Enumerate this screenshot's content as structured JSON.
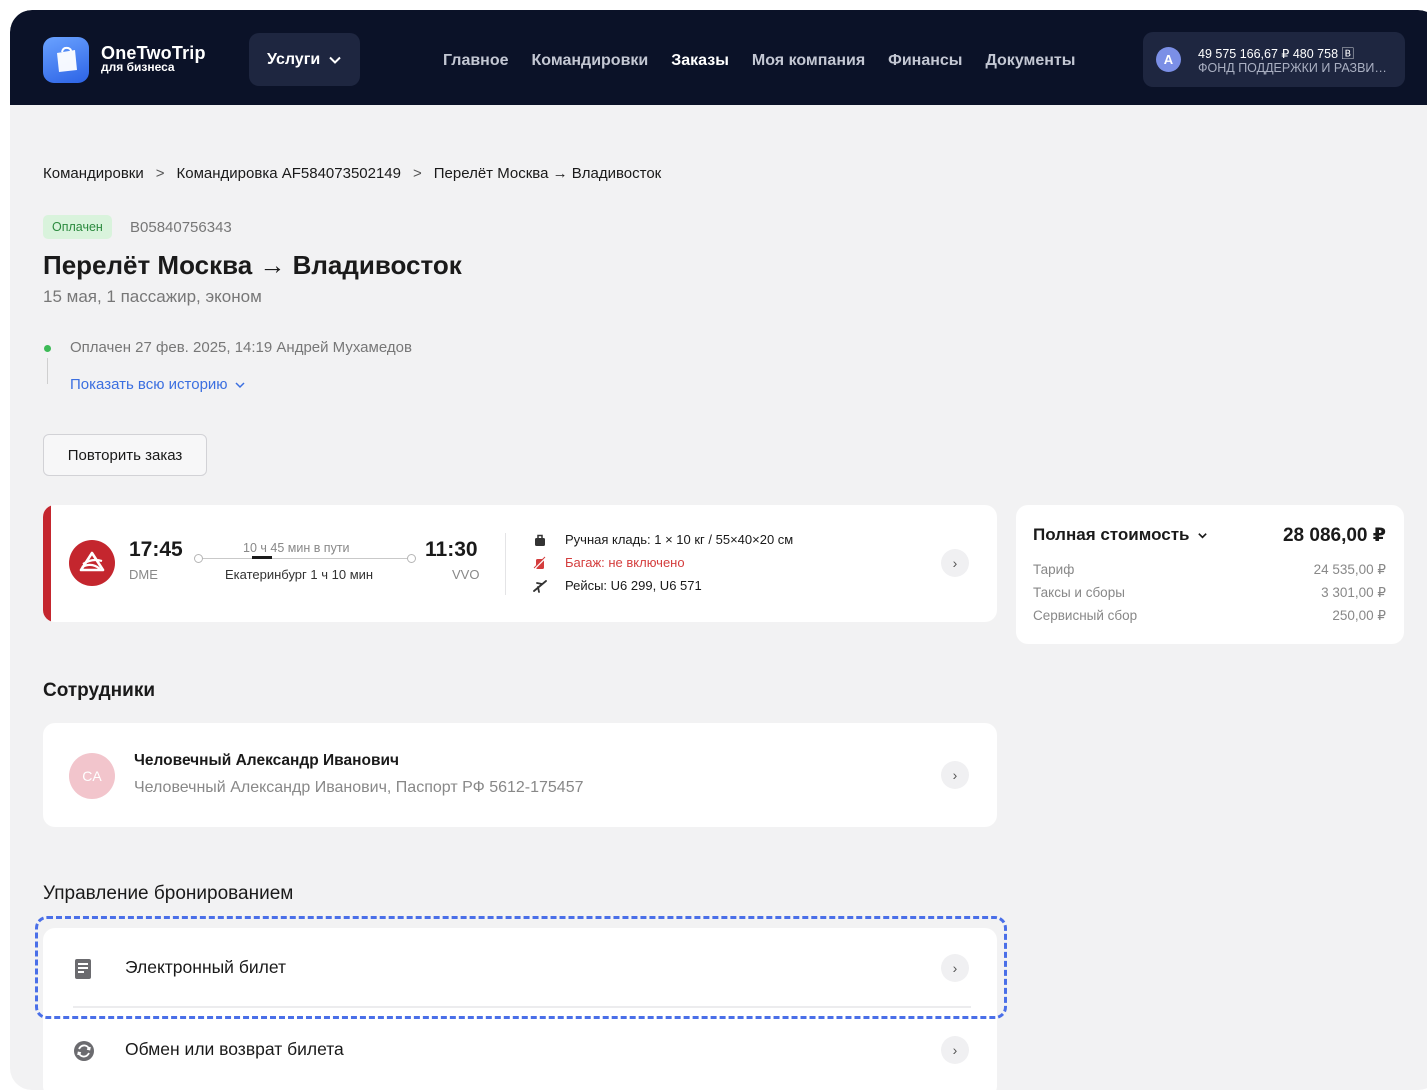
{
  "header": {
    "logo_title": "OneTwoTrip",
    "logo_sub": "для бизнеса",
    "services_label": "Услуги",
    "nav": [
      "Главное",
      "Командировки",
      "Заказы",
      "Моя компания",
      "Финансы",
      "Документы"
    ],
    "active_nav": "Заказы",
    "account": {
      "avatar_letter": "А",
      "balance": "49 575 166,67 ₽  480 758 🄱",
      "company": "ФОНД ПОДДЕРЖКИ И РАЗВИТИЯ"
    }
  },
  "breadcrumb": [
    "Командировки",
    "Командировка AF584073502149",
    "Перелёт Москва → Владивосток"
  ],
  "order": {
    "status": "Оплачен",
    "id": "B05840756343",
    "title": "Перелёт Москва → Владивосток",
    "subtitle": "15 мая, 1 пассажир, эконом",
    "history_entry": "Оплачен 27 фев. 2025, 14:19 Андрей Мухамедов",
    "history_link": "Показать всю историю",
    "repeat_label": "Повторить заказ"
  },
  "flight": {
    "dep_time": "17:45",
    "dep_code": "DME",
    "duration": "10 ч 45 мин в пути",
    "stop": "Екатеринбург 1 ч 10 мин",
    "arr_time": "11:30",
    "arr_code": "VVO",
    "carry_on": "Ручная кладь: 1 × 10 кг / 55×40×20 см",
    "baggage": "Багаж: не включено",
    "flights": "Рейсы: U6 299, U6 571",
    "airline_color": "#c4262e"
  },
  "price": {
    "title": "Полная стоимость",
    "total": "28 086,00 ₽",
    "rows": [
      {
        "label": "Тариф",
        "value": "24 535,00 ₽"
      },
      {
        "label": "Таксы и сборы",
        "value": "3 301,00 ₽"
      },
      {
        "label": "Сервисный сбор",
        "value": "250,00 ₽"
      }
    ]
  },
  "employees": {
    "title": "Сотрудники",
    "initials": "CA",
    "name": "Человечный Александр Иванович",
    "document": "Человечный Александр Иванович, Паспорт РФ 5612-175457"
  },
  "booking": {
    "title": "Управление бронированием",
    "items": [
      "Электронный билет",
      "Обмен или возврат билета"
    ]
  },
  "colors": {
    "header_bg": "#0b1228",
    "accent": "#3b6fe0",
    "highlight": "#4a6fe8",
    "paid_green": "#2b8a3e",
    "error_red": "#d43d3d"
  }
}
